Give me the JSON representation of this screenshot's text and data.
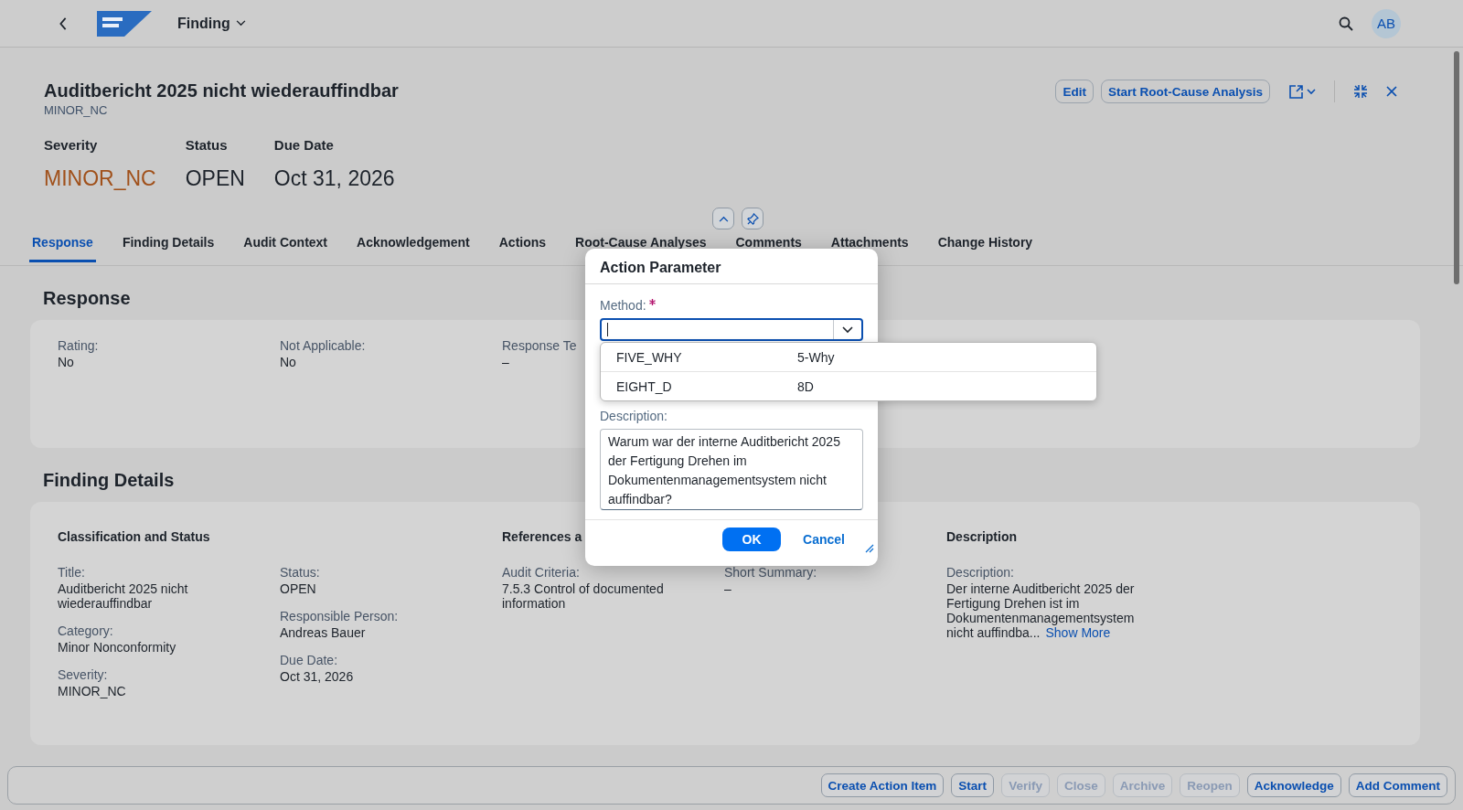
{
  "shell": {
    "app_title": "Finding",
    "user_initials": "AB"
  },
  "header": {
    "title": "Auditbericht 2025 nicht wiederauffindbar",
    "subtitle": "MINOR_NC",
    "actions": [
      "Edit",
      "Start Root-Cause Analysis"
    ],
    "kpis": [
      {
        "label": "Severity",
        "value": "MINOR_NC",
        "color": "#a0501a"
      },
      {
        "label": "Status",
        "value": "OPEN",
        "color": "#1d232b"
      },
      {
        "label": "Due Date",
        "value": "Oct 31, 2026",
        "color": "#1d232b"
      }
    ]
  },
  "tabs": [
    {
      "label": "Response",
      "selected": true
    },
    {
      "label": "Finding Details",
      "selected": false
    },
    {
      "label": "Audit Context",
      "selected": false
    },
    {
      "label": "Acknowledgement",
      "selected": false
    },
    {
      "label": "Actions",
      "selected": false
    },
    {
      "label": "Root-Cause Analyses",
      "selected": false
    },
    {
      "label": "Comments",
      "selected": false
    },
    {
      "label": "Attachments",
      "selected": false
    },
    {
      "label": "Change History",
      "selected": false
    }
  ],
  "response": {
    "title": "Response",
    "fields": [
      {
        "label": "Rating:",
        "value": "No"
      },
      {
        "label": "Not Applicable:",
        "value": "No"
      },
      {
        "label": "Response Te",
        "value": "–"
      }
    ]
  },
  "finding_details": {
    "title": "Finding Details",
    "groups": [
      {
        "heading": "Classification and Status",
        "columns": [
          [
            {
              "label": "Title:",
              "value": "Auditbericht 2025 nicht wiederauffindbar"
            },
            {
              "label": "Category:",
              "value": "Minor Nonconformity"
            },
            {
              "label": "Severity:",
              "value": "MINOR_NC"
            }
          ],
          [
            {
              "label": "Status:",
              "value": "OPEN"
            },
            {
              "label": "Responsible Person:",
              "value": "Andreas Bauer"
            },
            {
              "label": "Due Date:",
              "value": "Oct 31, 2026"
            }
          ]
        ]
      },
      {
        "heading": "References a",
        "columns": [
          [
            {
              "label": "Audit Criteria:",
              "value": "7.5.3 Control of documented information"
            }
          ],
          [
            {
              "label": "Short Summary:",
              "value": "–"
            }
          ]
        ]
      },
      {
        "heading": "Description",
        "columns": [
          [
            {
              "label": "Description:",
              "value": "Der interne Auditbericht 2025 der Fertigung Drehen ist im Dokumentenmanagementsystem nicht auffindba...",
              "link": "Show More"
            }
          ]
        ]
      }
    ]
  },
  "footer_actions": [
    {
      "label": "Create Action Item",
      "disabled": false
    },
    {
      "label": "Start",
      "disabled": false
    },
    {
      "label": "Verify",
      "disabled": true
    },
    {
      "label": "Close",
      "disabled": true
    },
    {
      "label": "Archive",
      "disabled": true
    },
    {
      "label": "Reopen",
      "disabled": true
    },
    {
      "label": "Acknowledge",
      "disabled": false
    },
    {
      "label": "Add Comment",
      "disabled": false
    }
  ],
  "dialog": {
    "title": "Action Parameter",
    "method": {
      "label": "Method:",
      "required": true,
      "focused": true
    },
    "options": [
      {
        "key": "FIVE_WHY",
        "text": "5-Why"
      },
      {
        "key": "EIGHT_D",
        "text": "8D"
      }
    ],
    "description": {
      "label": "Description:",
      "value": "Warum war der interne Auditbericht 2025 der Fertigung Drehen im Dokumentenmanagementsystem nicht auffindbar?"
    },
    "buttons": [
      {
        "label": "OK",
        "kind": "emphasized"
      },
      {
        "label": "Cancel",
        "kind": "transparent"
      }
    ]
  }
}
